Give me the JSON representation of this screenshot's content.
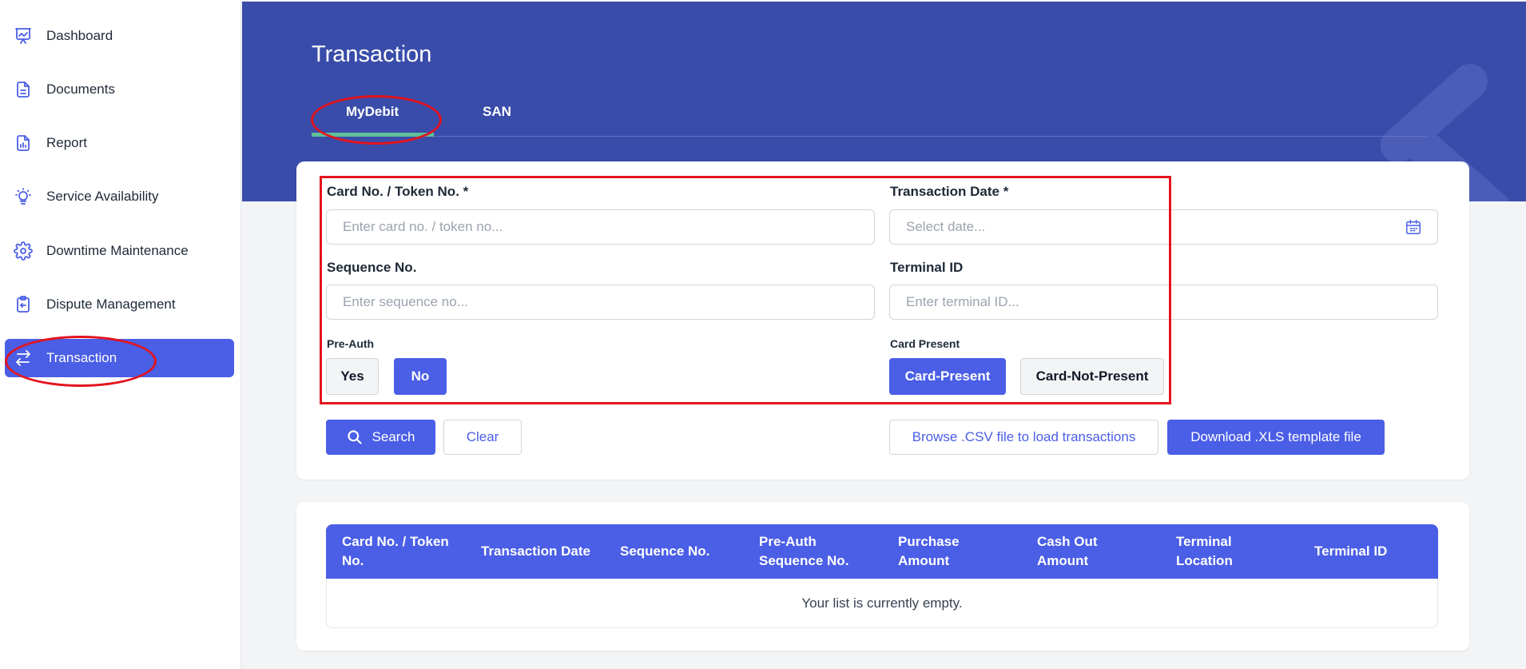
{
  "sidebar": {
    "items": [
      {
        "label": "Dashboard",
        "icon": "presentation-chart-icon"
      },
      {
        "label": "Documents",
        "icon": "document-icon"
      },
      {
        "label": "Report",
        "icon": "report-icon"
      },
      {
        "label": "Service Availability",
        "icon": "lightbulb-icon"
      },
      {
        "label": "Downtime Maintenance",
        "icon": "gear-icon"
      },
      {
        "label": "Dispute Management",
        "icon": "clipboard-return-icon"
      },
      {
        "label": "Transaction",
        "icon": "arrows-exchange-icon",
        "active": true
      }
    ]
  },
  "header": {
    "title": "Transaction",
    "tabs": [
      {
        "label": "MyDebit",
        "active": true
      },
      {
        "label": "SAN",
        "active": false
      }
    ]
  },
  "form": {
    "card_label": "Card No. / Token No. *",
    "card_placeholder": "Enter card no. / token no...",
    "date_label": "Transaction Date *",
    "date_placeholder": "Select date...",
    "sequence_label": "Sequence No.",
    "sequence_placeholder": "Enter sequence no...",
    "terminal_label": "Terminal ID",
    "terminal_placeholder": "Enter terminal ID...",
    "preauth_label": "Pre-Auth",
    "preauth_yes": "Yes",
    "preauth_no": "No",
    "preauth_selected": "No",
    "card_present_label": "Card Present",
    "card_present_option": "Card-Present",
    "card_not_present_option": "Card-Not-Present",
    "card_present_selected": "Card-Present"
  },
  "actions": {
    "search": "Search",
    "clear": "Clear",
    "browse_csv": "Browse .CSV file to load transactions",
    "download_xls": "Download .XLS template file"
  },
  "table": {
    "columns": [
      "Card No. / Token No.",
      "Transaction Date",
      "Sequence No.",
      "Pre-Auth Sequence No.",
      "Purchase Amount",
      "Cash Out Amount",
      "Terminal Location",
      "Terminal ID"
    ],
    "empty_message": "Your list is currently empty."
  },
  "colors": {
    "primary": "#4a5ee6",
    "banner": "#3a4caa",
    "tab_active_underline": "#5ec09a",
    "annotation": "#e3141e"
  }
}
